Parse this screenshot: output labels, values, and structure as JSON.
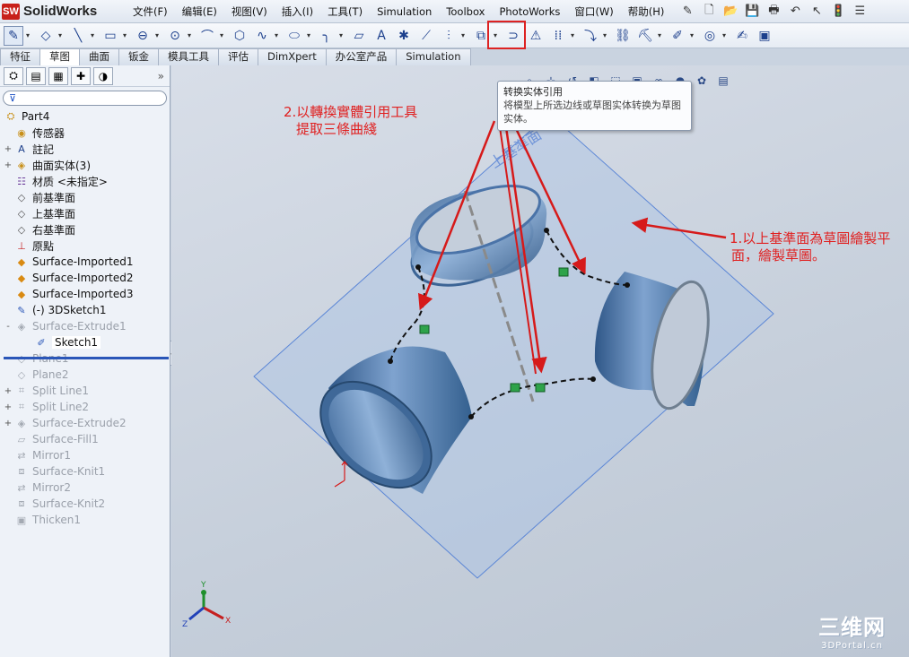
{
  "app": {
    "logo_badge": "SW",
    "logo_text": "SolidWorks"
  },
  "menu": [
    "文件(F)",
    "编辑(E)",
    "视图(V)",
    "插入(I)",
    "工具(T)",
    "Simulation",
    "Toolbox",
    "PhotoWorks",
    "窗口(W)",
    "帮助(H)"
  ],
  "tabs": [
    "特征",
    "草图",
    "曲面",
    "钣金",
    "模具工具",
    "评估",
    "DimXpert",
    "办公室产品",
    "Simulation"
  ],
  "active_tab": "草图",
  "tree": {
    "root": "Part4",
    "nodes": [
      {
        "label": "传感器",
        "icon": "sensor-icon",
        "exp": ""
      },
      {
        "label": "註記",
        "icon": "annotation-icon",
        "exp": "+"
      },
      {
        "label": "曲面实体(3)",
        "icon": "surface-bodies-icon",
        "exp": "+"
      },
      {
        "label": "材质 <未指定>",
        "icon": "material-icon",
        "exp": ""
      },
      {
        "label": "前基準面",
        "icon": "plane-icon",
        "exp": ""
      },
      {
        "label": "上基準面",
        "icon": "plane-icon",
        "exp": ""
      },
      {
        "label": "右基準面",
        "icon": "plane-icon",
        "exp": ""
      },
      {
        "label": "原點",
        "icon": "origin-icon",
        "exp": ""
      },
      {
        "label": "Surface-Imported1",
        "icon": "surface-imported-icon",
        "exp": ""
      },
      {
        "label": "Surface-Imported2",
        "icon": "surface-imported-icon",
        "exp": ""
      },
      {
        "label": "Surface-Imported3",
        "icon": "surface-imported-icon",
        "exp": ""
      },
      {
        "label": "(-) 3DSketch1",
        "icon": "3dsketch-icon",
        "exp": ""
      },
      {
        "label": "Surface-Extrude1",
        "icon": "surface-extrude-icon",
        "exp": "-",
        "dim": true
      },
      {
        "label": "Sketch1",
        "icon": "sketch-icon",
        "exp": "",
        "indent": true,
        "selected": true
      },
      {
        "label": "Plane1",
        "icon": "plane-icon",
        "exp": "",
        "dim": true
      },
      {
        "label": "Plane2",
        "icon": "plane-icon",
        "exp": "",
        "dim": true
      },
      {
        "label": "Split Line1",
        "icon": "split-line-icon",
        "exp": "+",
        "dim": true
      },
      {
        "label": "Split Line2",
        "icon": "split-line-icon",
        "exp": "+",
        "dim": true
      },
      {
        "label": "Surface-Extrude2",
        "icon": "surface-extrude-icon",
        "exp": "+",
        "dim": true
      },
      {
        "label": "Surface-Fill1",
        "icon": "surface-fill-icon",
        "exp": "",
        "dim": true
      },
      {
        "label": "Mirror1",
        "icon": "mirror-icon",
        "exp": "",
        "dim": true
      },
      {
        "label": "Surface-Knit1",
        "icon": "surface-knit-icon",
        "exp": "",
        "dim": true
      },
      {
        "label": "Mirror2",
        "icon": "mirror-icon",
        "exp": "",
        "dim": true
      },
      {
        "label": "Surface-Knit2",
        "icon": "surface-knit-icon",
        "exp": "",
        "dim": true
      },
      {
        "label": "Thicken1",
        "icon": "thicken-icon",
        "exp": "",
        "dim": true
      }
    ]
  },
  "tooltip": {
    "title": "转换实体引用",
    "body": "将模型上所选边线或草图实体转换为草图实体。"
  },
  "plane_label": "上基準面",
  "annotations": {
    "step2_line1": "2.以轉換實體引用工具",
    "step2_line2": "提取三條曲綫",
    "step1_line1": "1.以上基準面為草圖繪製平",
    "step1_line2": "面，繪製草圖。"
  },
  "axes": {
    "x": "X",
    "y": "Y",
    "z": "Z"
  },
  "watermark": {
    "main": "三维网",
    "sub": "3DPortal.cn"
  },
  "colors": {
    "annotation": "#e02020",
    "model_blue": "#4a73a8",
    "accent": "#2a56b8"
  }
}
